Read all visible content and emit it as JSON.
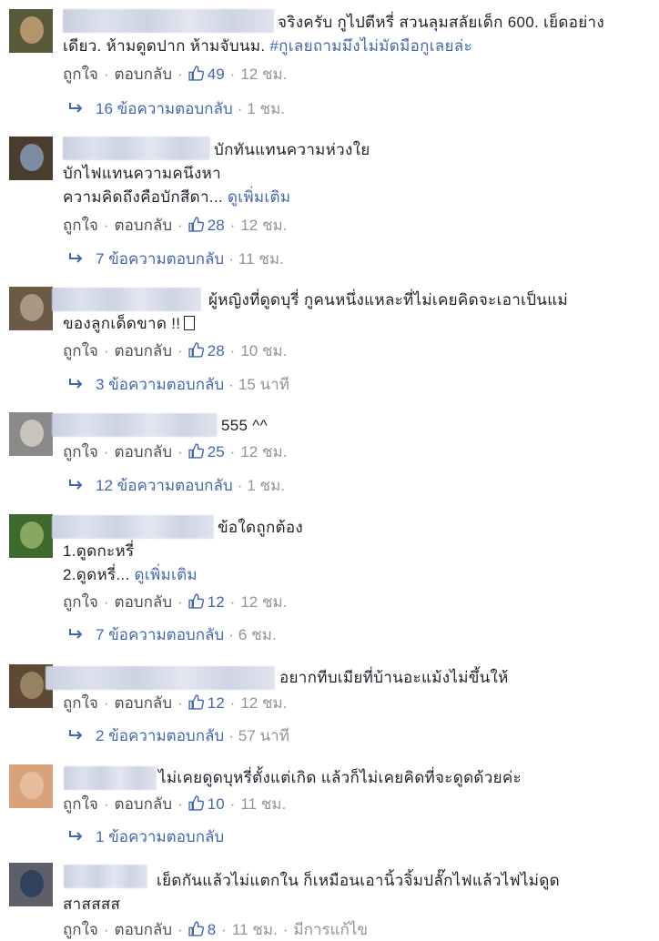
{
  "labels": {
    "like": "ถูกใจ",
    "reply": "ตอบกลับ",
    "edited": "มีการแก้ไข"
  },
  "colors": {
    "link": "#4267b2",
    "meta": "#90949c",
    "text": "#1d2129",
    "action": "#4b4f56"
  },
  "comments": [
    {
      "text": "จริงครับ กูไปตีหรี่ สวนลุมสลัยเด็ก 600. เย็ดอย่างเดียว. ห้ามดูดปาก ห้ามจับนม. ",
      "hashtag": "#กูเลยถามมึงไม่มัดมือกูเลยล่ะ",
      "likes": "49",
      "time": "12 ชม.",
      "replies_label": "16 ข้อความตอบกลับ",
      "replies_time": "1 ชม."
    },
    {
      "text": "บักทันแทนความห่วงใย",
      "line2": "บักไฟแทนความคนึงหา",
      "line3": "ความคิดถึงคือบักสีดา... ",
      "see_more": "ดูเพิ่มเติม",
      "likes": "28",
      "time": "12 ชม.",
      "replies_label": "7 ข้อความตอบกลับ",
      "replies_time": "11 ชม."
    },
    {
      "text": "ผู้หญิงที่ดูดบุรี่ กูคนหนึ่งแหละที่ไม่เคยคิดจะเอาเป็นแม่",
      "line2": "ของลูกเด็ดขาด !!",
      "likes": "28",
      "time": "10 ชม.",
      "replies_label": "3 ข้อความตอบกลับ",
      "replies_time": "15 นาที"
    },
    {
      "text": "555 ^^",
      "likes": "25",
      "time": "12 ชม.",
      "replies_label": "12 ข้อความตอบกลับ",
      "replies_time": "1 ชม."
    },
    {
      "text": "ข้อใดถูกต้อง",
      "line2": "1.ดูดกะหรี่",
      "line3": "2.ดูดหรี่... ",
      "see_more": "ดูเพิ่มเติม",
      "likes": "12",
      "time": "12 ชม.",
      "replies_label": "7 ข้อความตอบกลับ",
      "replies_time": "6 ชม."
    },
    {
      "text": "อยากทีบเมียที่บ้านอะแม้งไม่ขึ้นให้",
      "likes": "12",
      "time": "12 ชม.",
      "replies_label": "2 ข้อความตอบกลับ",
      "replies_time": "57 นาที"
    },
    {
      "text": "ไม่เคยดูดบุหรี่ตั้งแต่เกิด แล้วก็ไม่เคยคิดที่จะดูดด้วยค่ะ",
      "likes": "10",
      "time": "11 ชม.",
      "replies_label": "1 ข้อความตอบกลับ"
    },
    {
      "text": "เย็ดกันแล้วไม่แตกใน ก็เหมือนเอานิ้วจิ้มปลั๊กไฟแล้วไฟไม่ดูด",
      "line2": "สาสสสส",
      "likes": "8",
      "time": "11 ชม."
    }
  ]
}
